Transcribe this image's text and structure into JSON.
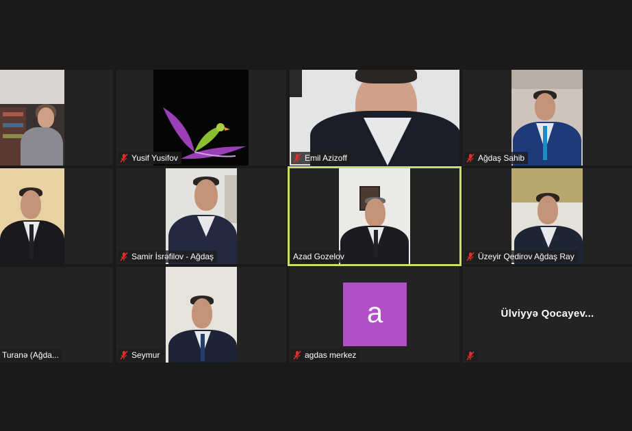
{
  "participants": [
    {
      "name": ""
    },
    {
      "name": "Yusif Yusifov"
    },
    {
      "name": "Emil Azizoff"
    },
    {
      "name": "Ağdaş Sahib"
    },
    {
      "name": ""
    },
    {
      "name": "Samir İsrəfilov - Ağdaş"
    },
    {
      "name": "Azad Gozelov"
    },
    {
      "name": "Üzeyir Qedirov Ağdaş Ray"
    },
    {
      "name": "Turanə  (Ağda..."
    },
    {
      "name": "Seymur"
    },
    {
      "name": "agdas merkez",
      "avatar_letter": "a",
      "avatar_color": "#b14fc7"
    },
    {
      "name": "",
      "display_name": "Ülviyyə  Qocayev..."
    }
  ],
  "colors": {
    "background": "#1a1a1a",
    "tile": "#232323",
    "active_speaker_border": "#c8e06a",
    "muted_mic": "#e02d2d"
  },
  "icons": {
    "muted": "microphone-muted-icon"
  }
}
